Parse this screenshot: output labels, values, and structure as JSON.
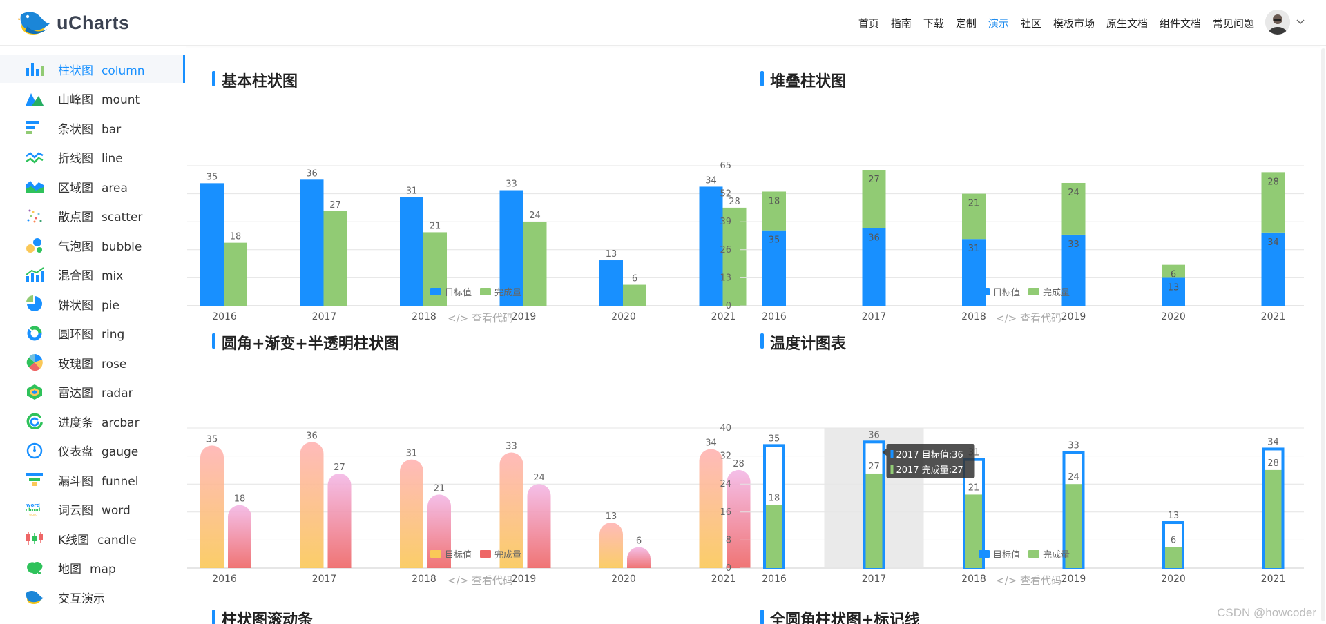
{
  "header": {
    "logo_text": "uCharts",
    "nav": [
      "首页",
      "指南",
      "下载",
      "定制",
      "演示",
      "社区",
      "模板市场",
      "原生文档",
      "组件文档",
      "常见问题"
    ],
    "active_nav_index": 4
  },
  "sidebar": {
    "items": [
      {
        "cn": "柱状图",
        "en": "column",
        "icon": "column-icon",
        "active": true
      },
      {
        "cn": "山峰图",
        "en": "mount",
        "icon": "mount-icon"
      },
      {
        "cn": "条状图",
        "en": "bar",
        "icon": "bar-icon"
      },
      {
        "cn": "折线图",
        "en": "line",
        "icon": "line-icon"
      },
      {
        "cn": "区域图",
        "en": "area",
        "icon": "area-icon"
      },
      {
        "cn": "散点图",
        "en": "scatter",
        "icon": "scatter-icon"
      },
      {
        "cn": "气泡图",
        "en": "bubble",
        "icon": "bubble-icon"
      },
      {
        "cn": "混合图",
        "en": "mix",
        "icon": "mix-icon"
      },
      {
        "cn": "饼状图",
        "en": "pie",
        "icon": "pie-icon"
      },
      {
        "cn": "圆环图",
        "en": "ring",
        "icon": "ring-icon"
      },
      {
        "cn": "玫瑰图",
        "en": "rose",
        "icon": "rose-icon"
      },
      {
        "cn": "雷达图",
        "en": "radar",
        "icon": "radar-icon"
      },
      {
        "cn": "进度条",
        "en": "arcbar",
        "icon": "arcbar-icon"
      },
      {
        "cn": "仪表盘",
        "en": "gauge",
        "icon": "gauge-icon"
      },
      {
        "cn": "漏斗图",
        "en": "funnel",
        "icon": "funnel-icon"
      },
      {
        "cn": "词云图",
        "en": "word",
        "icon": "word-icon"
      },
      {
        "cn": "K线图",
        "en": "candle",
        "icon": "candle-icon"
      },
      {
        "cn": "地图",
        "en": "map",
        "icon": "map-icon"
      },
      {
        "cn": "交互演示",
        "en": "",
        "icon": "bird-icon"
      }
    ]
  },
  "sections": {
    "s1": {
      "title": "基本柱状图",
      "code": "</> 查看代码"
    },
    "s2": {
      "title": "堆叠柱状图",
      "code": "</> 查看代码"
    },
    "s3": {
      "title": "圆角+渐变+半透明柱状图",
      "code": "</> 查看代码"
    },
    "s4": {
      "title": "温度计图表",
      "code": "</> 查看代码"
    },
    "s5": {
      "title": "柱状图滚动条"
    },
    "s6": {
      "title": "全圆角柱状图+标记线"
    }
  },
  "legend": {
    "target": "目标值",
    "done": "完成量"
  },
  "tooltip": [
    "2017 目标值:36",
    "2017 完成量:27"
  ],
  "colors": {
    "blue": "#1890ff",
    "green": "#91cb74",
    "accent": "#1f8cee",
    "grad_orange_top": "#ffb3b3",
    "grad_orange_bottom": "#fac858",
    "grad_red_top": "#f3b8e6",
    "grad_red_bottom": "#ee6666",
    "legend_orange": "#fac858",
    "legend_red": "#ee6666"
  },
  "watermark": "CSDN @howcoder",
  "chart_data": [
    {
      "type": "bar",
      "title": "基本柱状图",
      "categories": [
        "2016",
        "2017",
        "2018",
        "2019",
        "2020",
        "2021"
      ],
      "series": [
        {
          "name": "目标值",
          "values": [
            35,
            36,
            31,
            33,
            13,
            34
          ]
        },
        {
          "name": "完成量",
          "values": [
            18,
            27,
            21,
            24,
            6,
            28
          ]
        }
      ],
      "ylim": [
        0,
        40
      ],
      "legend": "bottom-center"
    },
    {
      "type": "bar",
      "title": "堆叠柱状图",
      "stacked": true,
      "categories": [
        "2016",
        "2017",
        "2018",
        "2019",
        "2020",
        "2021"
      ],
      "series": [
        {
          "name": "目标值",
          "values": [
            35,
            36,
            31,
            33,
            13,
            34
          ]
        },
        {
          "name": "完成量",
          "values": [
            18,
            27,
            21,
            24,
            6,
            28
          ]
        }
      ],
      "ylim": [
        0,
        65
      ],
      "yticks": [
        0,
        13,
        26,
        39,
        52,
        65
      ],
      "legend": "bottom-center"
    },
    {
      "type": "bar",
      "title": "圆角+渐变+半透明柱状图",
      "categories": [
        "2016",
        "2017",
        "2018",
        "2019",
        "2020",
        "2021"
      ],
      "series": [
        {
          "name": "目标值",
          "values": [
            35,
            36,
            31,
            33,
            13,
            34
          ]
        },
        {
          "name": "完成量",
          "values": [
            18,
            27,
            21,
            24,
            6,
            28
          ]
        }
      ],
      "ylim": [
        0,
        40
      ],
      "legend": "bottom-center"
    },
    {
      "type": "bar",
      "title": "温度计图表",
      "style": "thermometer",
      "categories": [
        "2016",
        "2017",
        "2018",
        "2019",
        "2020",
        "2021"
      ],
      "series": [
        {
          "name": "目标值",
          "values": [
            35,
            36,
            31,
            33,
            13,
            34
          ]
        },
        {
          "name": "完成量",
          "values": [
            18,
            27,
            21,
            24,
            6,
            28
          ]
        }
      ],
      "ylim": [
        0,
        40
      ],
      "yticks": [
        0,
        8,
        16,
        24,
        32,
        40
      ],
      "highlight_category": "2017",
      "legend": "bottom-center"
    }
  ]
}
